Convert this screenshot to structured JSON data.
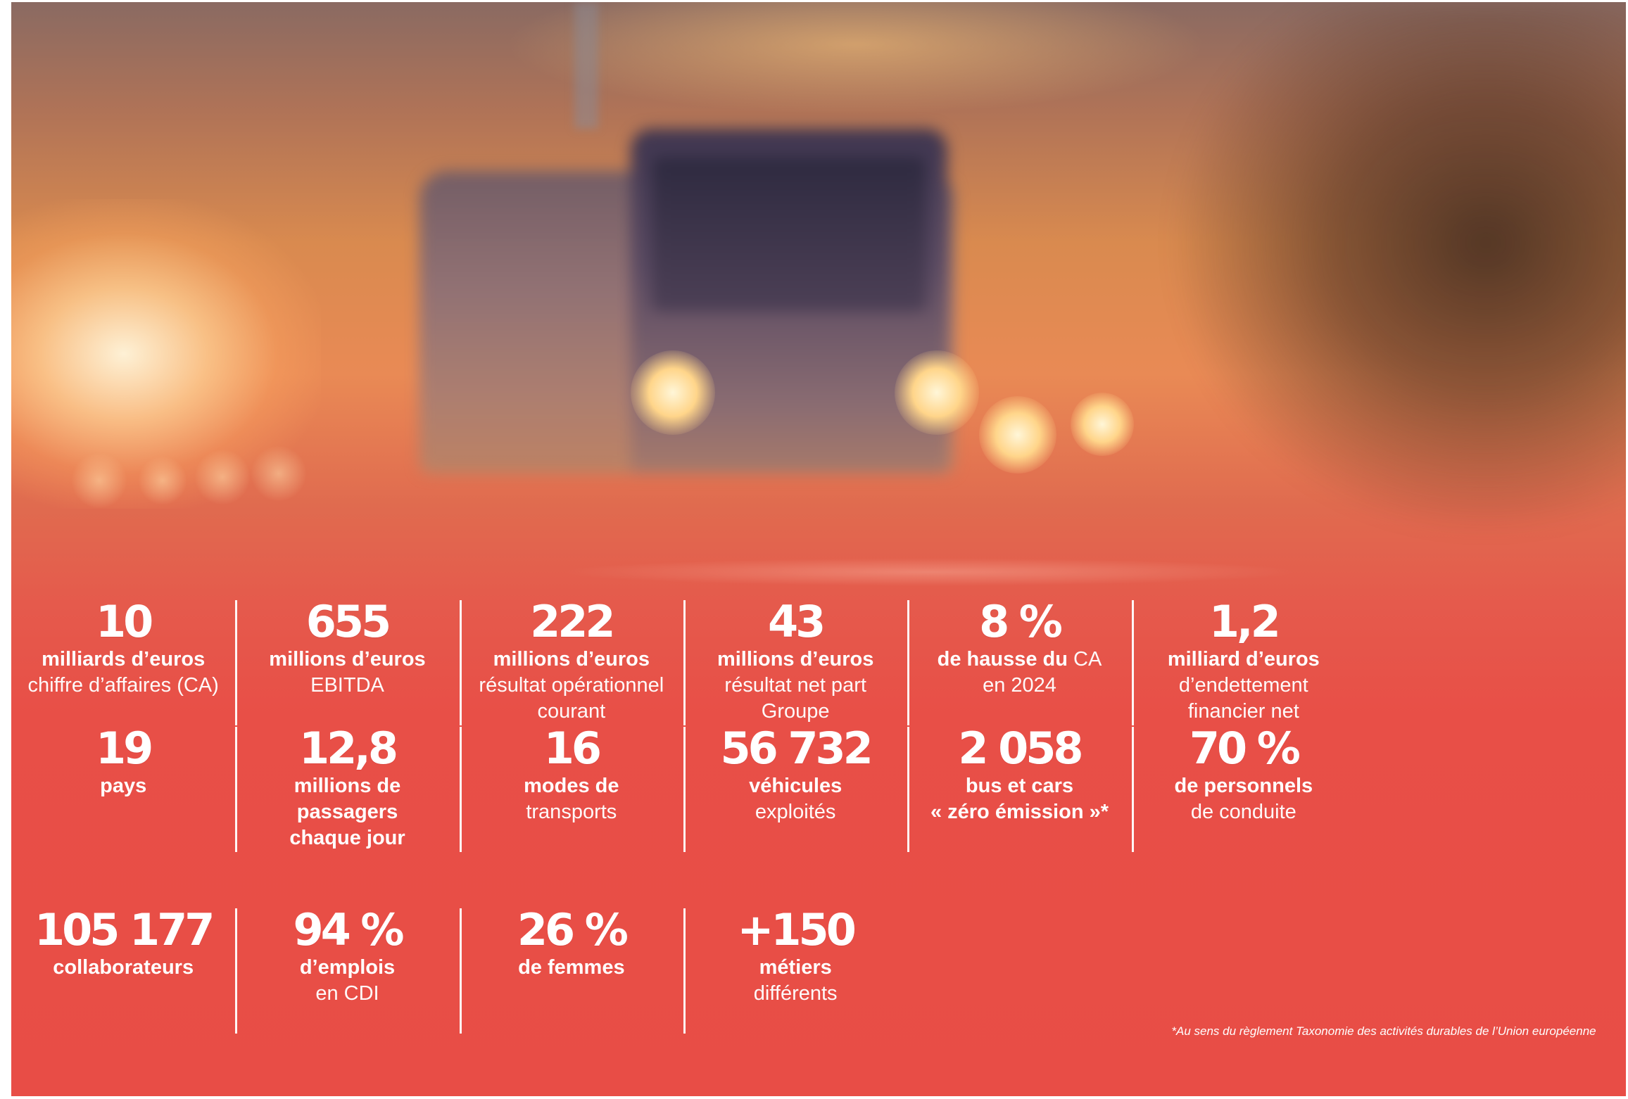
{
  "stats": [
    {
      "value": "10",
      "line1": "milliards d’euros",
      "line2": "chiffre d’affaires (CA)",
      "line3": ""
    },
    {
      "value": "655",
      "line1": "millions d’euros",
      "line2": "EBITDA",
      "line3": ""
    },
    {
      "value": "222",
      "line1": "millions d’euros",
      "line2": "résultat opérationnel",
      "line3": "courant"
    },
    {
      "value": "43",
      "line1": "millions d’euros",
      "line2": "résultat net part",
      "line3": "Groupe"
    },
    {
      "value": "8 %",
      "line1a": "de hausse du",
      "line1b": " CA",
      "line2": "en 2024",
      "line3": ""
    },
    {
      "value": "1,2",
      "line1": "milliard d’euros",
      "line2": "d’endettement",
      "line3": "financier net"
    },
    {
      "value": "19",
      "line1": "pays",
      "line2": "",
      "line3": ""
    },
    {
      "value": "12,8",
      "line1": "millions de",
      "line2": "passagers",
      "line3": "chaque jour"
    },
    {
      "value": "16",
      "line1": "modes de",
      "line2": "transports",
      "line3": ""
    },
    {
      "value": "56 732",
      "line1": "véhicules",
      "line2": "exploités",
      "line3": ""
    },
    {
      "value": "2 058",
      "line1": "bus et cars",
      "line2": "« zéro émission »*",
      "line3": ""
    },
    {
      "value": "70 %",
      "line1": "de personnels",
      "line2": "de conduite",
      "line3": ""
    },
    {
      "value": "105 177",
      "line1": "collaborateurs",
      "line2": "",
      "line3": ""
    },
    {
      "value": "94 %",
      "line1": "d’emplois",
      "line2": "en CDI",
      "line3": ""
    },
    {
      "value": "26 %",
      "line1": "de femmes",
      "line2": "",
      "line3": ""
    },
    {
      "value": "+150",
      "line1": "métiers",
      "line2": "différents",
      "line3": ""
    }
  ],
  "footnote": "*Au sens du règlement Taxonomie des activités durables de l’Union européenne"
}
